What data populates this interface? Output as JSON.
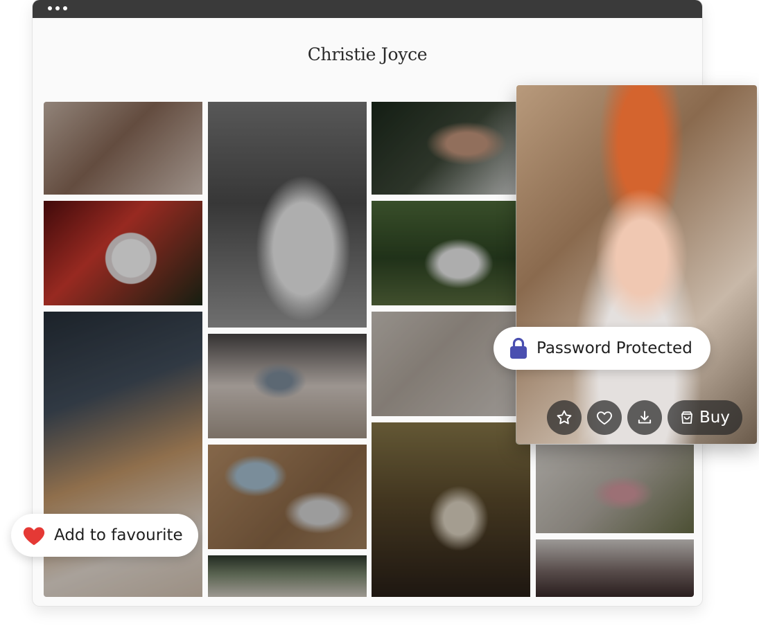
{
  "gallery": {
    "title": "Christie Joyce"
  },
  "photos": [
    {
      "id": "photo-1",
      "subject": "bride-portrait-flower-crown"
    },
    {
      "id": "photo-2",
      "subject": "bride-red-dress-bouquet"
    },
    {
      "id": "photo-3",
      "subject": "bride-black-and-white-bouquet"
    },
    {
      "id": "photo-4",
      "subject": "bride-showing-ring"
    },
    {
      "id": "photo-5",
      "subject": "bride-veil-outdoor"
    },
    {
      "id": "photo-6",
      "subject": "bride-in-vintage-car"
    },
    {
      "id": "photo-7",
      "subject": "couple-on-steps"
    },
    {
      "id": "photo-8",
      "subject": "lace-dress-detail"
    },
    {
      "id": "photo-9",
      "subject": "couple-by-stone-wall"
    },
    {
      "id": "photo-10",
      "subject": "church-ceremony"
    },
    {
      "id": "photo-11",
      "subject": "group-photo"
    },
    {
      "id": "photo-12",
      "subject": "bouquet-detail"
    },
    {
      "id": "photo-13",
      "subject": "couple-in-car"
    }
  ],
  "featured": {
    "subject": "redhead-bride-smiling",
    "actions": {
      "favourite_icon": "star-icon",
      "like_icon": "heart-outline-icon",
      "download_icon": "download-icon",
      "buy_icon": "shopping-bag-icon",
      "buy_label": "Buy"
    }
  },
  "badges": {
    "password": {
      "icon": "lock-icon",
      "label": "Password Protected",
      "icon_color": "#4a4fb0"
    },
    "favourite": {
      "icon": "heart-icon",
      "label": "Add to favourite",
      "icon_color": "#e53935"
    }
  }
}
